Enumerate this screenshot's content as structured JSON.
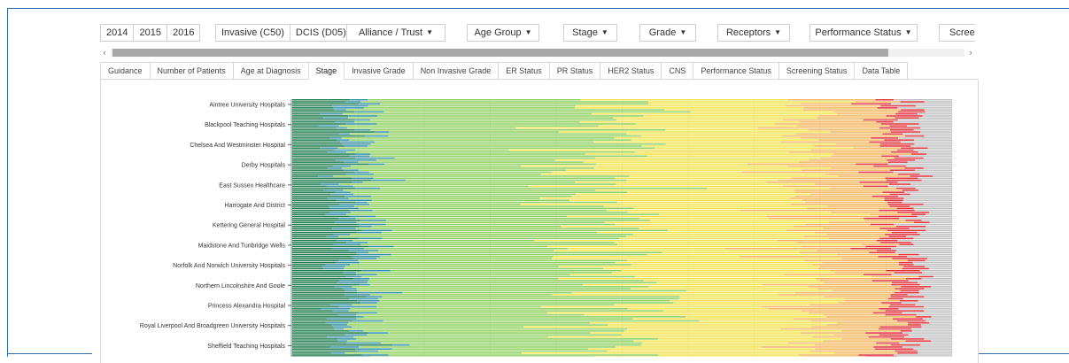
{
  "years": [
    "2014",
    "2015",
    "2016"
  ],
  "diagnosis_types": [
    "Invasive (C50)",
    "DCIS (D05)"
  ],
  "dropdowns": [
    {
      "label": "Alliance / Trust"
    },
    {
      "label": "Age Group"
    },
    {
      "label": "Stage"
    },
    {
      "label": "Grade"
    },
    {
      "label": "Receptors"
    },
    {
      "label": "Performance Status"
    },
    {
      "label": "Screen"
    }
  ],
  "scroll_left": "‹",
  "scroll_right": "›",
  "tabs": [
    "Guidance",
    "Number of Patients",
    "Age at Diagnosis",
    "Stage",
    "Invasive Grade",
    "Non Invasive Grade",
    "ER Status",
    "PR Status",
    "HER2 Status",
    "CNS",
    "Performance Status",
    "Screening Status",
    "Data Table"
  ],
  "active_tab": "Stage",
  "chart_data": {
    "type": "bar",
    "orientation": "horizontal",
    "stacked": "100%",
    "title": "",
    "xlabel": "",
    "ylabel": "",
    "xlim": [
      0,
      100
    ],
    "grid": true,
    "colors": {
      "stage_0": "#1a7a4c",
      "stage_1": "#2f8fa0",
      "stage_2": "#8ccf5a",
      "stage_3": "#f2e24a",
      "stage_4": "#f2b55a",
      "stage_5": "#e0303a",
      "unknown": "#bfbfbf"
    },
    "labeled_categories": [
      "Aintree University Hospitals",
      "Blackpool Teaching Hospitals",
      "Chelsea And Westminster Hospital",
      "Derby Hospitals",
      "East Sussex Healthcare",
      "Harrogate And District",
      "Kettering General Hospital",
      "Maidstone And Tunbridge Wells",
      "Norfolk And Norwich University Hospitals",
      "Northern Lincolnshire And Goole",
      "Princess Alexandra Hospital",
      "Royal Liverpool And Broadgreen University Hospitals",
      "Sheffield Teaching Hospitals"
    ],
    "typical_share_percent": {
      "dark_green": 8,
      "teal": 2,
      "green": 38,
      "yellow": 30,
      "orange": 12,
      "red": 4,
      "grey": 6
    }
  }
}
